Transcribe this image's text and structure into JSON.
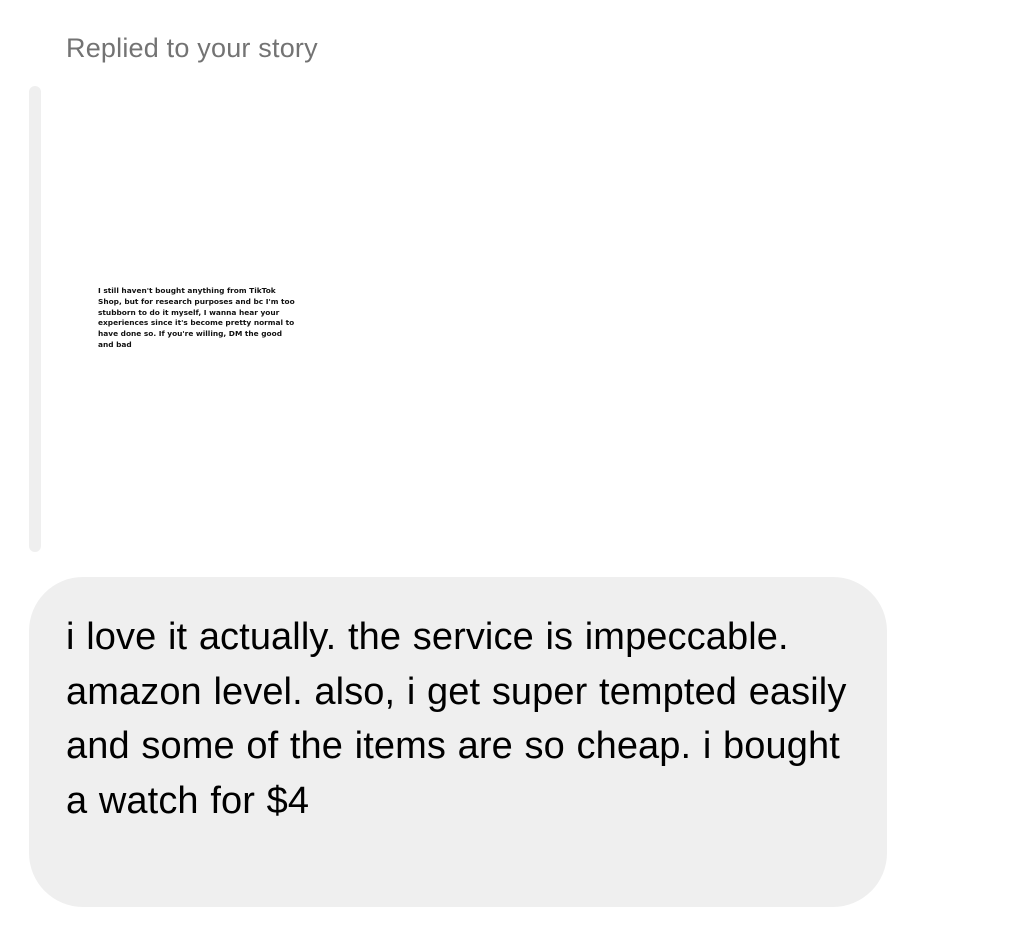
{
  "reply": {
    "label": "Replied to your story"
  },
  "story": {
    "text": "I still haven't bought anything from TikTok Shop, but for research purposes and bc I'm too stubborn to do it myself, I wanna hear your experiences since it's become pretty normal to have done so. If you're willing, DM the good and bad"
  },
  "message": {
    "text": "i love it actually. the service is impeccable. amazon level. also, i get super tempted easily and some of the items are so cheap. i bought a watch for $4"
  },
  "colors": {
    "bubble_background": "#efefef",
    "label_text": "#737373",
    "message_text": "#000000"
  }
}
